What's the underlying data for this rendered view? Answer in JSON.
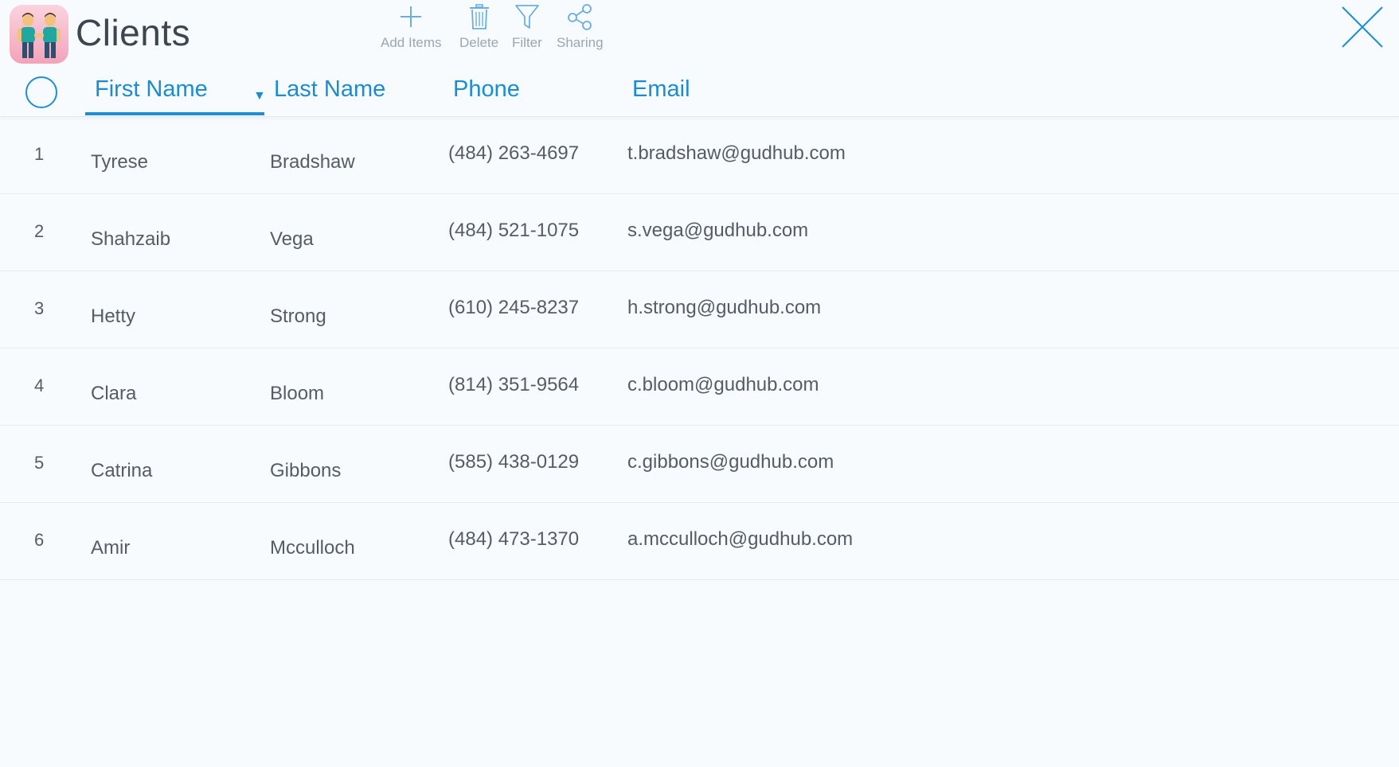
{
  "app": {
    "title": "Clients",
    "icon": "two-people-icon"
  },
  "toolbar": {
    "add_label": "Add Items",
    "delete_label": "Delete",
    "filter_label": "Filter",
    "sharing_label": "Sharing"
  },
  "colors": {
    "accent": "#1a8dd0",
    "text": "#555c66",
    "toolbar_text": "#9aa6b2",
    "background": "#f8fbfd"
  },
  "columns": {
    "first_name": "First Name",
    "last_name": "Last Name",
    "phone": "Phone",
    "email": "Email",
    "sorted_by": "First Name"
  },
  "rows": [
    {
      "num": "1",
      "first": "Tyrese",
      "last": "Bradshaw",
      "phone": "(484) 263-4697",
      "email": "t.bradshaw@gudhub.com"
    },
    {
      "num": "2",
      "first": "Shahzaib",
      "last": "Vega",
      "phone": "(484) 521-1075",
      "email": "s.vega@gudhub.com"
    },
    {
      "num": "3",
      "first": "Hetty",
      "last": "Strong",
      "phone": "(610) 245-8237",
      "email": "h.strong@gudhub.com"
    },
    {
      "num": "4",
      "first": "Clara",
      "last": "Bloom",
      "phone": "(814) 351-9564",
      "email": "c.bloom@gudhub.com"
    },
    {
      "num": "5",
      "first": "Catrina",
      "last": "Gibbons",
      "phone": "(585) 438-0129",
      "email": "c.gibbons@gudhub.com"
    },
    {
      "num": "6",
      "first": "Amir",
      "last": "Mcculloch",
      "phone": "(484) 473-1370",
      "email": "a.mcculloch@gudhub.com"
    }
  ]
}
